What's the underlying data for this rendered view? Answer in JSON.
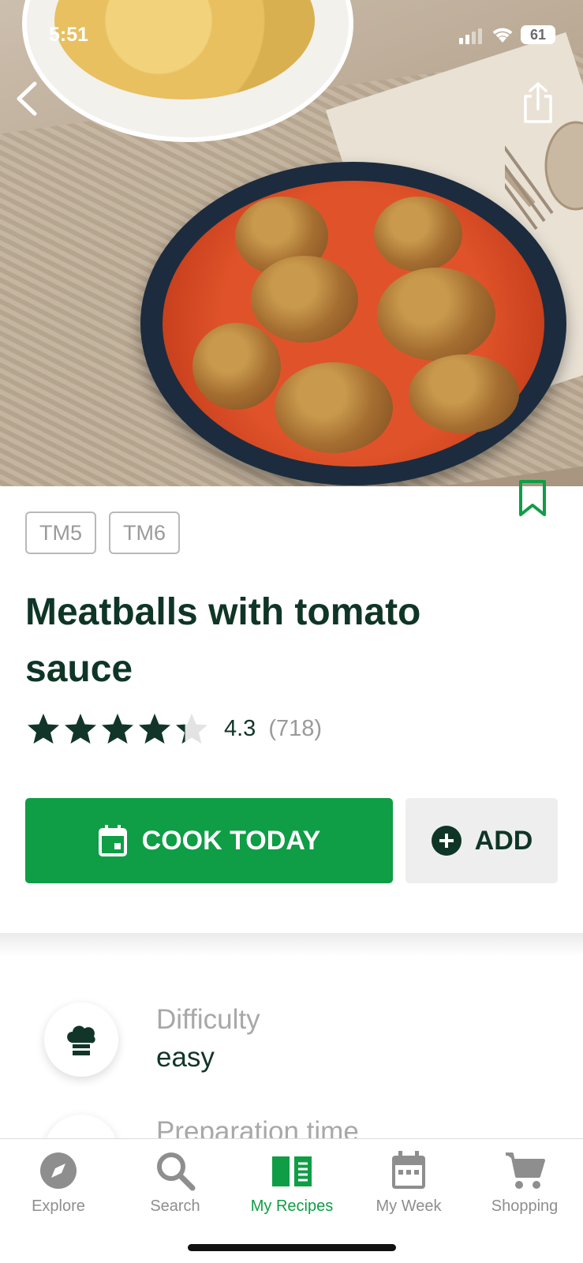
{
  "status_bar": {
    "time": "5:51",
    "battery": "61"
  },
  "recipe": {
    "tags": [
      "TM5",
      "TM6"
    ],
    "title": "Meatballs with tomato sauce",
    "rating_value": "4.3",
    "rating_count": "(718)",
    "rating_stars": 4.3
  },
  "actions": {
    "cook_today": "COOK TODAY",
    "add": "ADD"
  },
  "info": [
    {
      "label": "Difficulty",
      "value": "easy",
      "icon": "chef-hat-icon"
    },
    {
      "label": "Preparation time",
      "value": "",
      "icon": "clock-icon"
    }
  ],
  "tabs": [
    {
      "label": "Explore",
      "icon": "compass-icon",
      "active": false
    },
    {
      "label": "Search",
      "icon": "search-icon",
      "active": false
    },
    {
      "label": "My Recipes",
      "icon": "book-icon",
      "active": true
    },
    {
      "label": "My Week",
      "icon": "calendar-icon",
      "active": false
    },
    {
      "label": "Shopping",
      "icon": "cart-icon",
      "active": false
    }
  ],
  "colors": {
    "primary_green": "#0f9d45",
    "dark_text": "#0f3527"
  }
}
